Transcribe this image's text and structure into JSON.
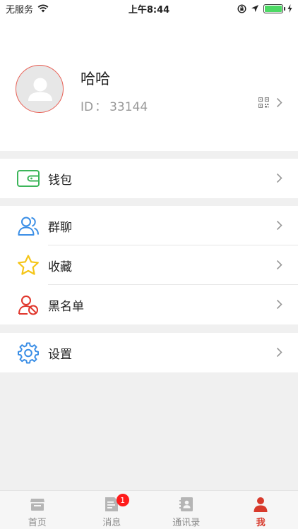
{
  "status_bar": {
    "carrier": "无服务",
    "time": "上午8:44",
    "battery_color": "#4cd964"
  },
  "profile": {
    "nickname": "哈哈",
    "id_label": "ID",
    "id_separator": "：",
    "id_value": "33144",
    "avatar_border_color": "#e85d52"
  },
  "menu": {
    "wallet": {
      "label": "钱包",
      "icon": "wallet-icon",
      "color": "#3cb55a"
    },
    "group_chat": {
      "label": "群聊",
      "icon": "group-chat-icon",
      "color": "#3a8ee6"
    },
    "favorites": {
      "label": "收藏",
      "icon": "star-icon",
      "color": "#f5c518"
    },
    "blacklist": {
      "label": "黑名单",
      "icon": "blacklist-icon",
      "color": "#e0352b"
    },
    "settings": {
      "label": "设置",
      "icon": "gear-icon",
      "color": "#3a8ee6"
    }
  },
  "tabbar": {
    "tabs": [
      {
        "label": "首页",
        "icon": "home-store-icon"
      },
      {
        "label": "消息",
        "icon": "message-icon",
        "badge": "1"
      },
      {
        "label": "通讯录",
        "icon": "contacts-icon"
      },
      {
        "label": "我",
        "icon": "person-icon",
        "active": true
      }
    ],
    "active_color": "#d83a2c",
    "badge_color": "#ff1a1a"
  }
}
